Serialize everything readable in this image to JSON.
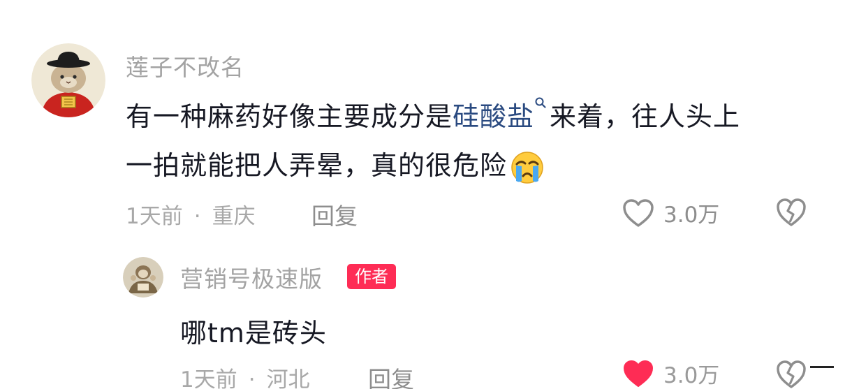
{
  "comment": {
    "username": "莲子不改名",
    "text_before_link": "有一种麻药好像主要成分是",
    "link_text": "硅酸盐",
    "text_after_link": "来着，往人头上",
    "text_line2": "一拍就能把人弄晕，真的很危险",
    "time": "1天前",
    "location": "重庆",
    "reply_label": "回复",
    "likes": "3.0万"
  },
  "reply": {
    "username": "营销号极速版",
    "badge": "作者",
    "text": "哪tm是砖头",
    "time": "1天前",
    "location": "河北",
    "reply_label": "回复",
    "likes": "3.0万"
  },
  "colors": {
    "like_active": "#fe2c55",
    "badge_bg": "#fe2c55",
    "link": "#2a4a80"
  }
}
